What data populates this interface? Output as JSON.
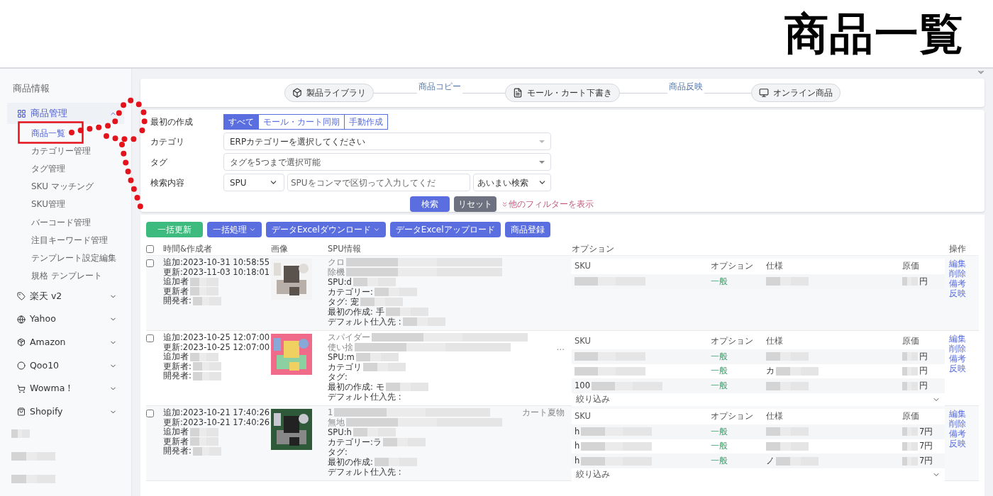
{
  "page_heading": "商品一覧",
  "sidebar": {
    "section": "商品情報",
    "group": {
      "label": "商品管理",
      "expanded": true,
      "children": [
        {
          "label": "商品一覧",
          "selected": true
        },
        {
          "label": "カテゴリー管理",
          "selected": false
        },
        {
          "label": "タグ管理",
          "selected": false
        },
        {
          "label": "SKU マッチング",
          "selected": false
        },
        {
          "label": "SKU管理",
          "selected": false
        },
        {
          "label": "バーコード管理",
          "selected": false
        },
        {
          "label": "注目キーワード管理",
          "selected": false
        },
        {
          "label": "テンプレート設定編集",
          "selected": false
        },
        {
          "label": "規格 テンプレート",
          "selected": false
        }
      ]
    },
    "platforms": [
      {
        "label": "楽天 v2",
        "kind": "tag",
        "expanded": false
      },
      {
        "label": "Yahoo",
        "kind": "globe",
        "expanded": false
      },
      {
        "label": "Amazon",
        "kind": "package",
        "expanded": false
      },
      {
        "label": "Qoo10",
        "kind": "circle",
        "expanded": false
      },
      {
        "label": "Wowma！",
        "kind": "cart",
        "expanded": false
      },
      {
        "label": "Shopify",
        "kind": "bag",
        "expanded": false
      }
    ]
  },
  "steps": {
    "items": [
      "製品ライブラリ",
      "モール・カート下書き",
      "オンライン商品"
    ],
    "connectors": [
      "商品コピー",
      "商品反映"
    ]
  },
  "filters": {
    "creation": {
      "label": "最初の作成",
      "options": [
        {
          "label": "すべて",
          "selected": true
        },
        {
          "label": "モール・カート同期",
          "selected": false
        },
        {
          "label": "手動作成",
          "selected": false
        }
      ]
    },
    "category": {
      "label": "カテゴリ",
      "placeholder": "ERPカテゴリーを選択してください"
    },
    "tag": {
      "label": "タグ",
      "placeholder": "タグを5つまで選択可能"
    },
    "search": {
      "label": "検索内容",
      "field": "SPU",
      "placeholder": "SPUをコンマで区切って入力してくだ",
      "mode": "あいまい検索"
    },
    "search_button": "検索",
    "reset_button": "リセット",
    "more_filters": "他のフィルターを表示"
  },
  "actions": [
    {
      "label": "一括更新",
      "kind": "green",
      "dropdown": false
    },
    {
      "label": "一括処理",
      "kind": "blue",
      "dropdown": true
    },
    {
      "label": "データExcelダウンロード",
      "kind": "blue",
      "dropdown": true
    },
    {
      "label": "データExcelアップロード",
      "kind": "blue",
      "dropdown": false
    },
    {
      "label": "商品登録",
      "kind": "blue",
      "dropdown": false
    }
  ],
  "table": {
    "select_all_checked": false,
    "columns": [
      "時間&作成者",
      "画像",
      "SPU情報",
      "オプション",
      "操作"
    ],
    "rows": [
      {
        "checked": false,
        "times": [
          {
            "text": "追加:2023-10-31 10:58:55"
          },
          {
            "text": "更新:2023-11-03 10:18:01"
          },
          {
            "text": "追加者",
            "redacted_after": true
          },
          {
            "text": "更新者",
            "redacted_after": true
          },
          {
            "text": "開発者:",
            "redacted_after": true
          }
        ],
        "spu": [
          {
            "text": "クロ",
            "redacted_after": true
          },
          {
            "text": "除機",
            "redacted_after": true
          },
          {
            "text": "SPU:d",
            "redacted_after": true
          },
          {
            "text": "カテゴリー:",
            "redacted_after": true
          },
          {
            "text": "タグ: 宠",
            "redacted_after": true
          },
          {
            "text": "最初の作成: 手",
            "redacted_after": true
          },
          {
            "text": "デフォルト仕入先 :",
            "redacted_after": true
          }
        ],
        "sku_columns": [
          "SKU",
          "オプション",
          "仕様",
          "原価"
        ],
        "skus": [
          {
            "sku": {
              "redacted_after": true
            },
            "option": "一般",
            "spec": {
              "redacted_after": true
            },
            "price": {
              "text": "円",
              "redacted_before": true
            }
          }
        ],
        "ops": [
          "編集",
          "削除",
          "備考",
          "反映"
        ]
      },
      {
        "checked": false,
        "times": [
          {
            "text": "追加:2023-10-25 12:07:00"
          },
          {
            "text": "更新:2023-10-25 12:07:00"
          },
          {
            "text": "追加者",
            "redacted_after": true
          },
          {
            "text": "更新者:",
            "redacted_after": true
          },
          {
            "text": "開発者:",
            "redacted_after": true
          }
        ],
        "spu": [
          {
            "text": "スパイダー",
            "redacted_after": true
          },
          {
            "text": "使い捨",
            "redacted_after": true,
            "suffix": "…"
          },
          {
            "text": "SPU:m",
            "redacted_after": true
          },
          {
            "text": "カテゴリ",
            "redacted_after": true
          },
          {
            "text": "タグ:"
          },
          {
            "text": "最初の作成: モ",
            "redacted_after": true
          },
          {
            "text": "デフォルト仕入先 :"
          }
        ],
        "sku_columns": [
          "SKU",
          "オプション",
          "仕様",
          "原価"
        ],
        "skus": [
          {
            "sku": {
              "redacted_after": true
            },
            "option": "一般",
            "spec": {
              "redacted_after": true
            },
            "price": {
              "text": "円",
              "redacted_before": true
            }
          },
          {
            "sku": {
              "redacted_after": true
            },
            "option": "一般",
            "spec": {
              "text": "カ",
              "redacted_after": true
            },
            "price": {
              "text": "円",
              "redacted_before": true
            }
          },
          {
            "sku": {
              "text": "100",
              "redacted_after": true
            },
            "option": "一般",
            "spec": {
              "redacted_after": true
            },
            "price": {
              "text": "円",
              "redacted_before": true
            }
          }
        ],
        "filter_label": "絞り込み",
        "ops": [
          "編集",
          "削除",
          "備考",
          "反映"
        ]
      },
      {
        "checked": false,
        "times": [
          {
            "text": "追加:2023-10-21 17:40:26"
          },
          {
            "text": "更新:2023-10-21 17:40:26"
          },
          {
            "text": "追加者",
            "redacted_after": true
          },
          {
            "text": "更新者",
            "redacted_after": true
          },
          {
            "text": "開発者:",
            "redacted_after": true
          }
        ],
        "spu": [
          {
            "text": "1",
            "redacted_after": true,
            "suffix": "カート夏物"
          },
          {
            "text": "無地",
            "redacted_after": true
          },
          {
            "text": "SPU:h",
            "redacted_after": true
          },
          {
            "text": "カテゴリー:ラ",
            "redacted_after": true
          },
          {
            "text": "タグ:"
          },
          {
            "text": "最初の作成:",
            "redacted_after": true
          },
          {
            "text": "デフォルト仕入先 :"
          }
        ],
        "sku_columns": [
          "SKU",
          "オプション",
          "仕様",
          "原価"
        ],
        "skus": [
          {
            "sku": {
              "text": "h",
              "redacted_after": true
            },
            "option": "一般",
            "spec": {
              "redacted_after": true
            },
            "price": {
              "text": "7円",
              "redacted_before": true
            }
          },
          {
            "sku": {
              "text": "h",
              "redacted_after": true
            },
            "option": "一般",
            "spec": {
              "redacted_after": true
            },
            "price": {
              "text": "7円",
              "redacted_before": true
            }
          },
          {
            "sku": {
              "text": "h",
              "redacted_after": true
            },
            "option": "一般",
            "spec": {
              "text": "ノ",
              "redacted_after": true
            },
            "price": {
              "text": "7円",
              "redacted_before": true
            }
          }
        ],
        "filter_label": "絞り込み",
        "ops": [
          "編集",
          "削除",
          "備考",
          "反映"
        ]
      }
    ]
  }
}
